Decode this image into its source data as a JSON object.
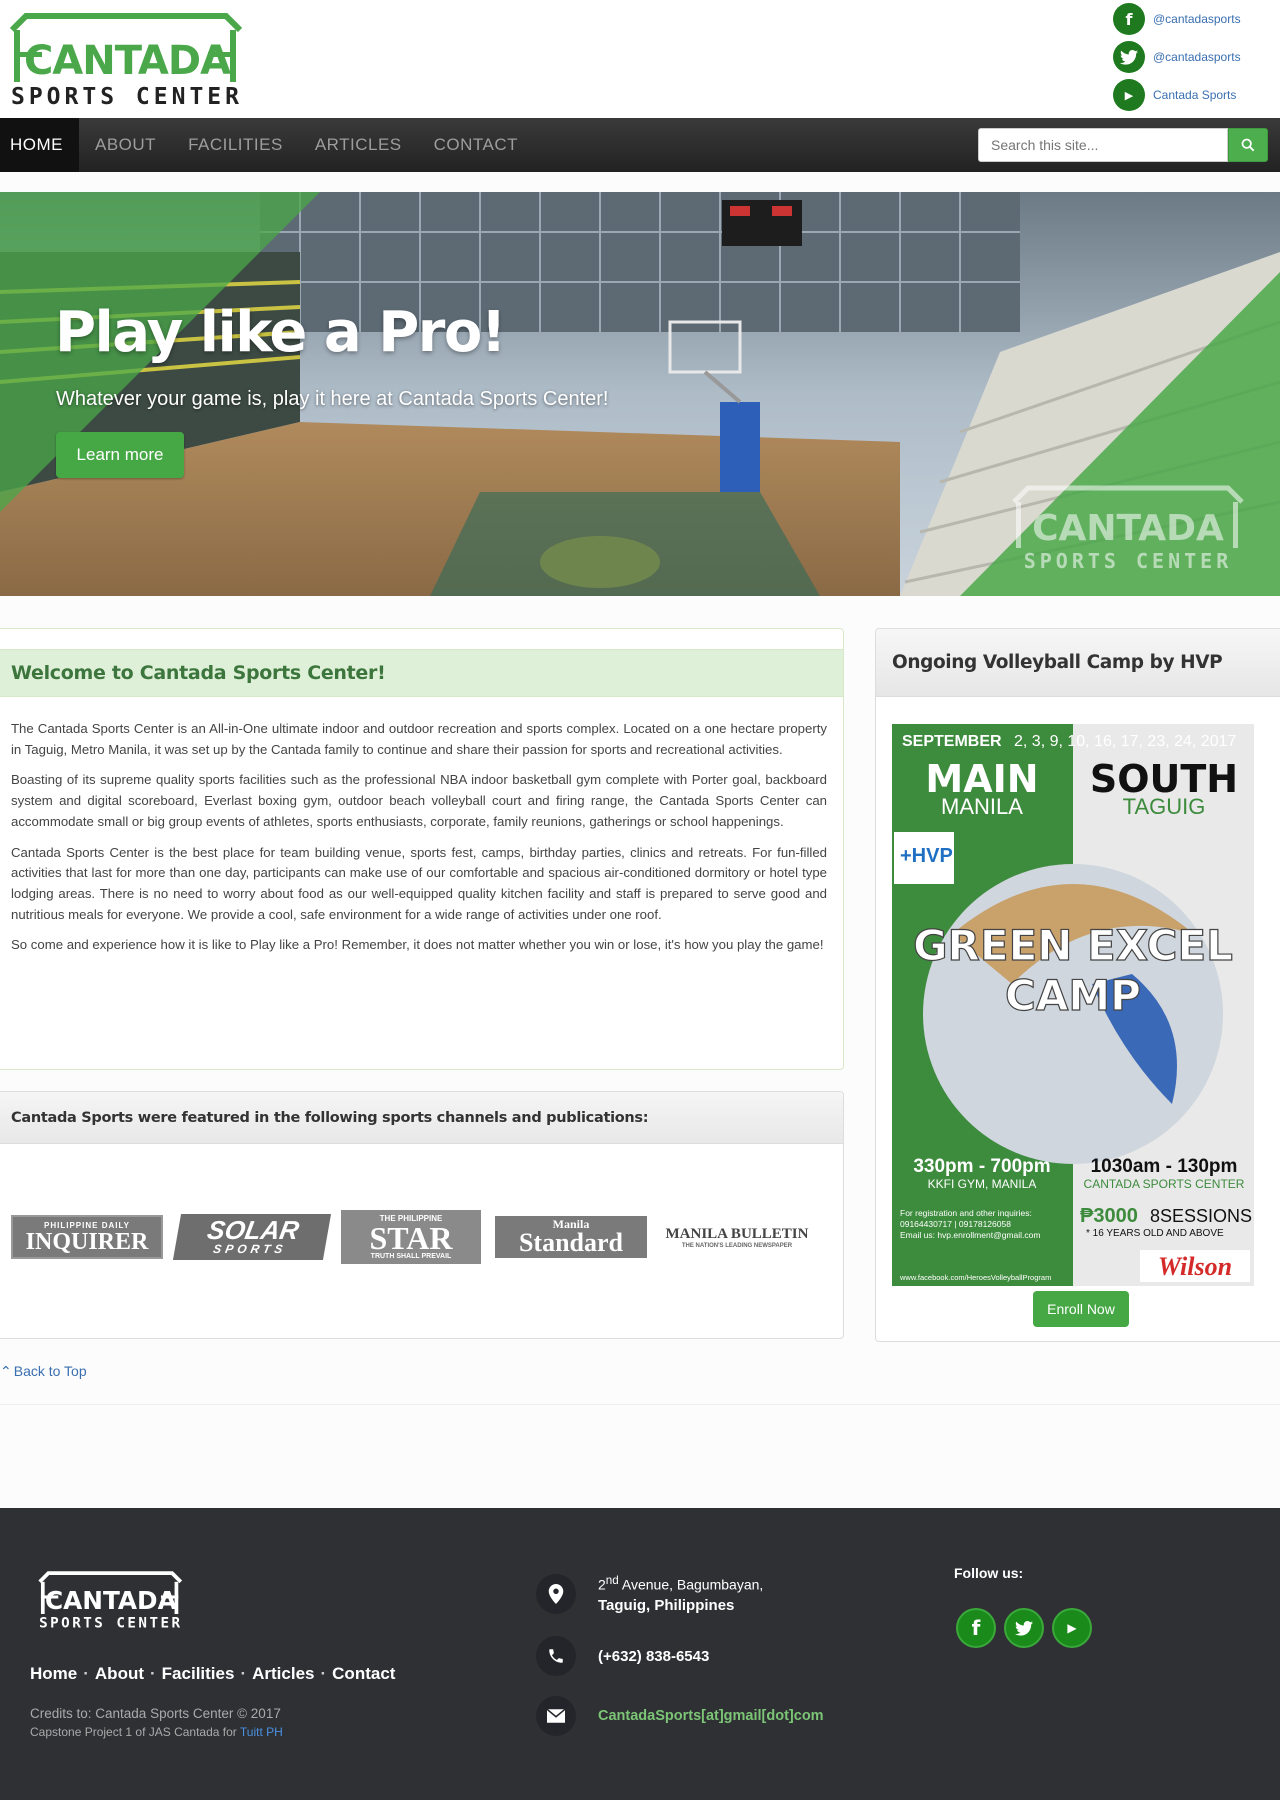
{
  "brand": {
    "name_top": "CANTADA",
    "name_bottom": "SPORTS CENTER"
  },
  "social_top": [
    {
      "icon": "facebook-icon",
      "glyph": "f",
      "label": "@cantadasports"
    },
    {
      "icon": "twitter-icon",
      "glyph": "t",
      "label": "@cantadasports"
    },
    {
      "icon": "youtube-icon",
      "glyph": "▶",
      "label": "Cantada Sports"
    }
  ],
  "nav": {
    "items": [
      "HOME",
      "ABOUT",
      "FACILITIES",
      "ARTICLES",
      "CONTACT"
    ],
    "active_index": 0,
    "search_placeholder": "Search this site..."
  },
  "hero": {
    "title": "Play like a Pro!",
    "subtitle": "Whatever your game is, play it here at Cantada Sports Center!",
    "button": "Learn more"
  },
  "welcome": {
    "title": "Welcome to Cantada Sports Center!",
    "paragraphs": [
      "The Cantada Sports Center is an All-in-One ultimate indoor and outdoor recreation and sports complex. Located on a one hectare property in Taguig, Metro Manila, it was set up by the Cantada family to continue and share their passion for sports and recreational activities.",
      "Boasting of its supreme quality sports facilities such as the professional NBA indoor basketball gym complete with Porter goal, backboard system and digital scoreboard, Everlast boxing gym, outdoor beach volleyball court and firing range, the Cantada Sports Center can accommodate small or big group events of athletes, sports enthusiasts, corporate, family reunions, gatherings or school happenings.",
      "Cantada Sports Center is the best place for team building venue, sports fest, camps, birthday parties, clinics and retreats. For fun-filled activities that last for more than one day, participants can make use of our comfortable and spacious air-conditioned dormitory or hotel type lodging areas. There is no need to worry about food as our well-equipped quality kitchen facility and staff is prepared to serve good and nutritious meals for everyone. We provide a cool, safe environment for a wide range of activities under one roof.",
      "So come and experience how it is like to Play like a Pro! Remember, it does not matter whether you win or lose, it's how you play the game!"
    ]
  },
  "featured": {
    "title": "Cantada Sports were featured in the following sports channels and publications:",
    "publications": [
      {
        "name": "INQUIRER",
        "top": "PHILIPPINE DAILY"
      },
      {
        "name": "SOLAR",
        "top": "SPORTS"
      },
      {
        "name": "STAR",
        "top": "THE PHILIPPINE",
        "bottom": "TRUTH SHALL PREVAIL"
      },
      {
        "name": "Standard",
        "top": "Manila"
      },
      {
        "name": "MANILA BULLETIN",
        "top": "",
        "bottom": "THE NATION'S LEADING NEWSPAPER"
      }
    ]
  },
  "camp": {
    "title": "Ongoing Volleyball Camp by HVP",
    "poster": {
      "month": "SEPTEMBER",
      "dates": "2, 3, 9, 10, 16, 17, 23, 24, 2017",
      "left_venue": "MAIN",
      "left_city": "MANILA",
      "right_venue": "SOUTH",
      "right_city": "TAGUIG",
      "badge": "+HVP",
      "headline1": "GREEN EXCEL",
      "headline2": "CAMP",
      "left_time": "330pm - 700pm",
      "left_place": "KKFI GYM, MANILA",
      "right_time": "1030am - 130pm",
      "right_place": "CANTADA SPORTS CENTER",
      "info1": "For registration and other inquiries:",
      "info2": "09164430717 | 09178126058",
      "info3": "Email us: hvp.enrollment@gmail.com",
      "price": "₱3000",
      "sessions": "8SESSIONS",
      "age": "* 16 YEARS OLD AND ABOVE",
      "url": "www.facebook.com/HeroesVolleyballProgram",
      "sponsor": "Wilson"
    },
    "button": "Enroll Now"
  },
  "back_to_top": "Back to Top",
  "footer": {
    "nav": [
      "Home",
      "About",
      "Facilities",
      "Articles",
      "Contact"
    ],
    "credits": "Credits to: Cantada Sports Center © 2017",
    "capstone": "Capstone Project 1 of JAS Cantada for ",
    "tuitt": "Tuitt PH",
    "address_line1_pre": "2",
    "address_line1_sup": "nd",
    "address_line1_post": " Avenue, Bagumbayan,",
    "address_line2": "Taguig, Philippines",
    "phone": "(+632) 838-6543",
    "email": "CantadaSports[at]gmail[dot]com",
    "follow_label": "Follow us:"
  },
  "colors": {
    "brand_green": "#45a845",
    "dark_green": "#1f7a1f",
    "nav_bg": "#222222",
    "footer_bg": "#2e3033"
  }
}
